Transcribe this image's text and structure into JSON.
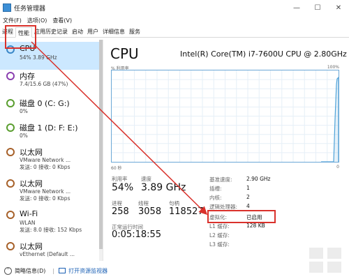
{
  "window": {
    "title": "任务管理器",
    "minimize": "—",
    "maximize": "☐",
    "close": "✕"
  },
  "menu": [
    "文件(F)",
    "选项(O)",
    "查看(V)"
  ],
  "tabs": [
    "进程",
    "性能",
    "应用历史记录",
    "启动",
    "用户",
    "详细信息",
    "服务"
  ],
  "active_tab_index": 1,
  "sidebar": {
    "items": [
      {
        "name": "CPU",
        "sub1": "54%  3.89 GHz",
        "sub2": "",
        "selected": true
      },
      {
        "name": "内存",
        "sub1": "7.4/15.6 GB (47%)",
        "sub2": "",
        "selected": false
      },
      {
        "name": "磁盘 0 (C: G:)",
        "sub1": "0%",
        "sub2": "",
        "selected": false
      },
      {
        "name": "磁盘 1 (D: F: E:)",
        "sub1": "0%",
        "sub2": "",
        "selected": false
      },
      {
        "name": "以太网",
        "sub1": "VMware Network ...",
        "sub2": "发送: 0 接收: 0 Kbps",
        "selected": false
      },
      {
        "name": "以太网",
        "sub1": "VMware Network ...",
        "sub2": "发送: 0 接收: 0 Kbps",
        "selected": false
      },
      {
        "name": "Wi-Fi",
        "sub1": "WLAN",
        "sub2": "发送: 8.0 接收: 152 Kbps",
        "selected": false
      },
      {
        "name": "以太网",
        "sub1": "vEthernet (Default ...",
        "sub2": "",
        "selected": false
      }
    ]
  },
  "main": {
    "heading": "CPU",
    "model": "Intel(R) Core(TM) i7-7600U CPU @ 2.80GHz",
    "graph_label_left": "% 利用率",
    "graph_label_right": "100%",
    "graph_foot_left": "60 秒",
    "graph_foot_right": "0",
    "stats": {
      "util_label": "利用率",
      "util_value": "54%",
      "speed_label": "速度",
      "speed_value": "3.89 GHz",
      "proc_label": "进程",
      "proc_value": "258",
      "thread_label": "线程",
      "thread_value": "3058",
      "handle_label": "句柄",
      "handle_value": "118527",
      "uptime_label": "正常运行时间",
      "uptime_value": "0:05:18:55"
    },
    "info": [
      {
        "label": "基准速度:",
        "value": "2.90 GHz"
      },
      {
        "label": "插槽:",
        "value": "1"
      },
      {
        "label": "内核:",
        "value": "2"
      },
      {
        "label": "逻辑处理器:",
        "value": "4"
      },
      {
        "label": "虚拟化:",
        "value": "已启用"
      },
      {
        "label": "L1 缓存:",
        "value": "128 KB"
      },
      {
        "label": "L2 缓存:",
        "value": ""
      },
      {
        "label": "L3 缓存:",
        "value": ""
      }
    ]
  },
  "footer": {
    "less": "简略信息(D)",
    "sep": "|",
    "link": "打开资源监视器"
  },
  "colors": {
    "accent": "#1a5fb4",
    "graph_line": "#4fa3d9",
    "highlight": "#d9312b",
    "selected": "#cce8ff"
  }
}
